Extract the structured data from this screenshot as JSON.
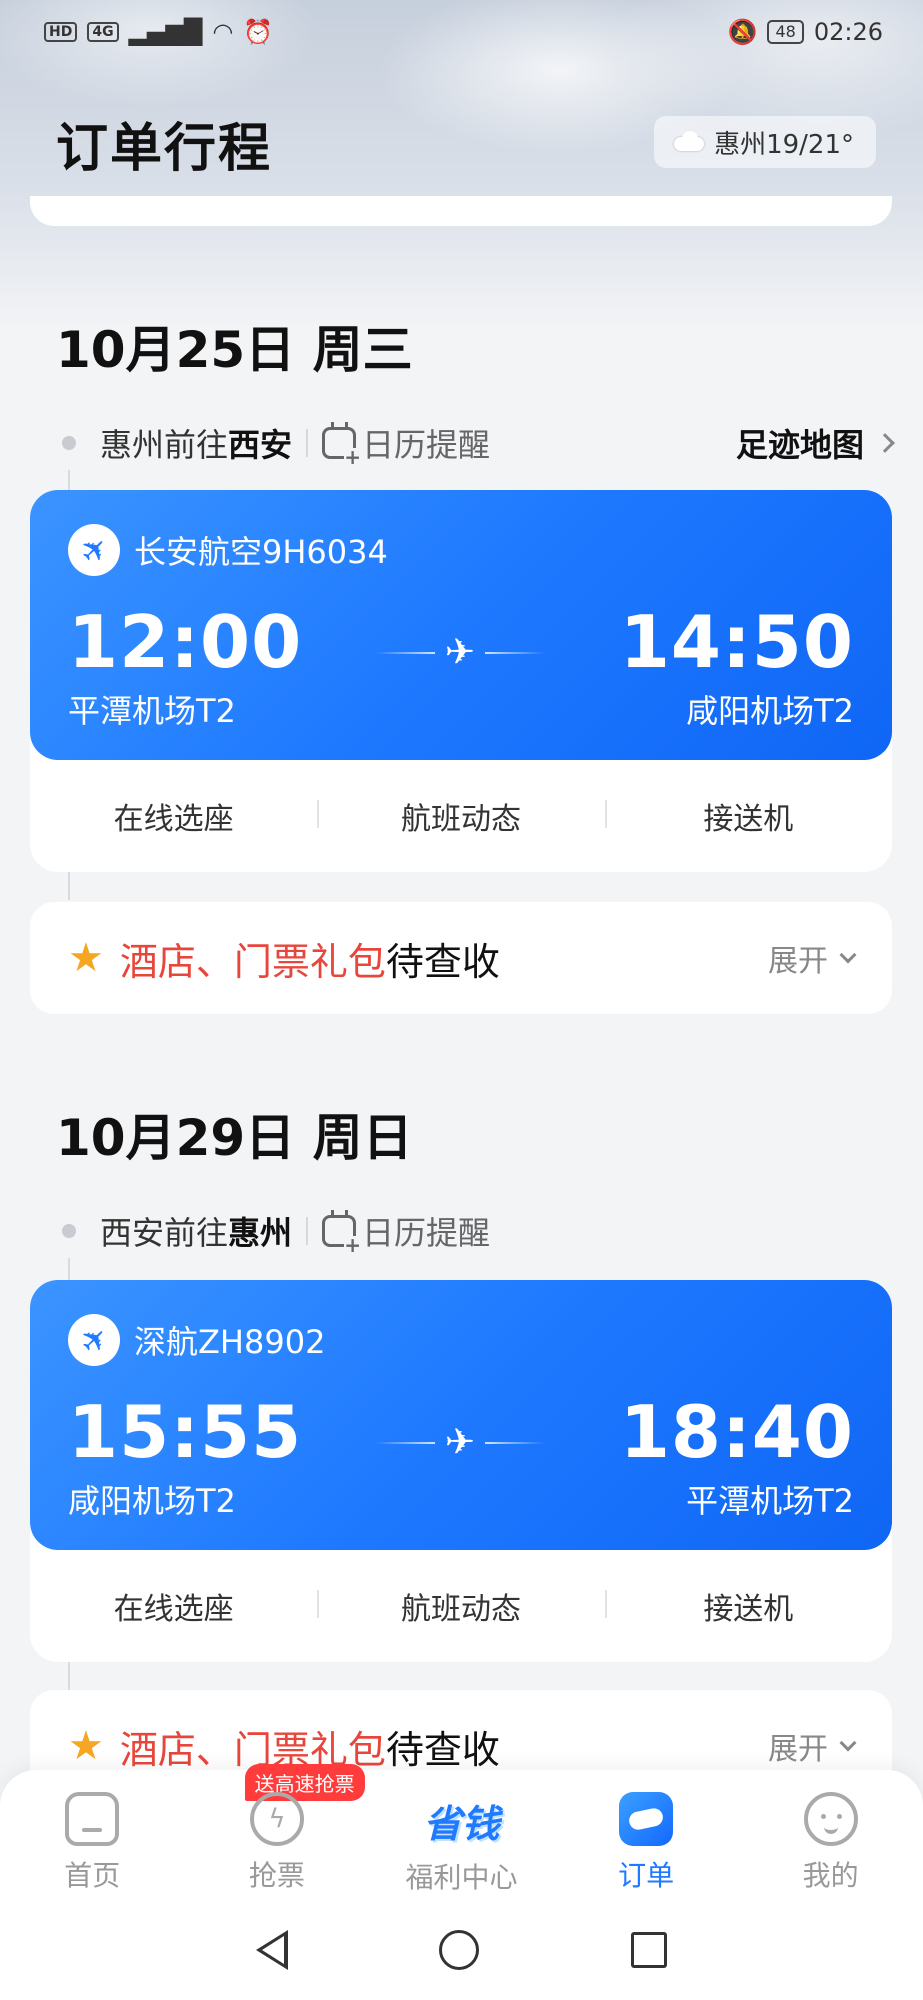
{
  "status_bar": {
    "left_tags": [
      "HD",
      "4G"
    ],
    "battery": "48",
    "time": "02:26"
  },
  "header": {
    "title": "订单行程",
    "weather": "惠州19/21°"
  },
  "trips": [
    {
      "date": "10月25日 周三",
      "route_prefix": "惠州前往",
      "route_dest": "西安",
      "calendar_label": "日历提醒",
      "footprint_label": "足迹地图",
      "airline": "长安航空9H6034",
      "dep_time": "12:00",
      "dep_airport": "平潭机场T2",
      "arr_time": "14:50",
      "arr_airport": "咸阳机场T2",
      "actions": [
        "在线选座",
        "航班动态",
        "接送机"
      ],
      "promo_red": "酒店、门票礼包",
      "promo_black": "待查收",
      "expand_label": "展开"
    },
    {
      "date": "10月29日 周日",
      "route_prefix": "西安前往",
      "route_dest": "惠州",
      "calendar_label": "日历提醒",
      "airline": "深航ZH8902",
      "dep_time": "15:55",
      "dep_airport": "咸阳机场T2",
      "arr_time": "18:40",
      "arr_airport": "平潭机场T2",
      "actions": [
        "在线选座",
        "航班动态",
        "接送机"
      ],
      "promo_red": "酒店、门票礼包",
      "promo_black": "待查收",
      "expand_label": "展开"
    }
  ],
  "tabbar": {
    "items": [
      {
        "label": "首页",
        "icon": "home-icon"
      },
      {
        "label": "抢票",
        "icon": "lightning-icon",
        "badge": "送高速抢票"
      },
      {
        "label": "福利中心",
        "icon": "save-money-icon",
        "icon_text": "省钱"
      },
      {
        "label": "订单",
        "icon": "order-icon",
        "active": true
      },
      {
        "label": "我的",
        "icon": "face-icon"
      }
    ]
  },
  "colors": {
    "accent": "#1f7aff",
    "promo_red": "#e8463b",
    "badge_red": "#ff3b3b"
  }
}
